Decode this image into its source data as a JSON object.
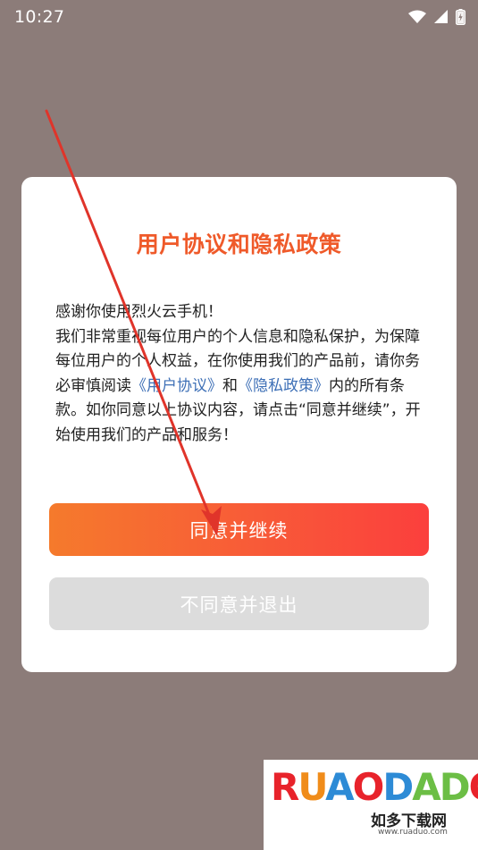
{
  "status_bar": {
    "time": "10:27",
    "icons": [
      "wifi-icon",
      "signal-icon",
      "battery-charging-icon"
    ]
  },
  "dialog": {
    "title": "用户协议和隐私政策",
    "body": {
      "line1": "感谢你使用烈火云手机！",
      "para_start": "我们非常重视每位用户的个人信息和隐私保护，为保障每位用户的个人权益，在你使用我们的产品前，请你务必审慎阅读",
      "link_user_agreement": "《用户协议》",
      "and": "和",
      "link_privacy_policy": "《隐私政策》",
      "para_end": "内的所有条款。如你同意以上协议内容，请点击“同意并继续”，开始使用我们的产品和服务！"
    },
    "agree_button": "同意并继续",
    "decline_button": "不同意并退出"
  },
  "colors": {
    "title": "#ef5a2a",
    "link": "#3d6fb6",
    "agree_gradient_start": "#f57a2c",
    "agree_gradient_end": "#fb3f3d",
    "decline_bg": "#dcdcdc",
    "overlay": "#8c7c79"
  },
  "watermark": {
    "logo_text": "RUAODADO",
    "logo_letters": [
      "R",
      "U",
      "A",
      "O",
      "D",
      "A",
      "D",
      "O"
    ],
    "subtitle": "如多下载网",
    "url": "www.ruaduo.com"
  }
}
